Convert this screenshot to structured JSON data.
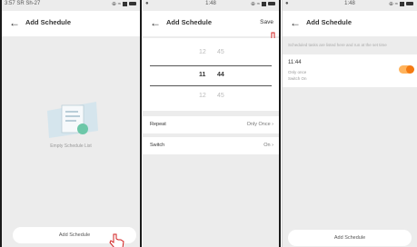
{
  "screens": [
    {
      "status": {
        "left": "3:57 SR Sh-27",
        "center": "1:46",
        "right": "⊕ ≈"
      },
      "header": {
        "back_icon": "arrow-left-icon",
        "title": "Add Schedule"
      },
      "empty": {
        "icon": "document-icon",
        "text": "Empty Schedule List"
      },
      "button": {
        "label": "Add Schedule"
      }
    },
    {
      "status": {
        "left": "●",
        "center": "1:48",
        "right": "⊕ ≈"
      },
      "header": {
        "back_icon": "arrow-left-icon",
        "title": "Add Schedule",
        "save": "Save"
      },
      "picker": {
        "hours": [
          "12",
          "11",
          "12"
        ],
        "minutes": [
          "45",
          "44",
          "45"
        ]
      },
      "settings": [
        {
          "label": "Repeat",
          "value": "Only Once"
        },
        {
          "label": "Switch",
          "value": "On"
        }
      ]
    },
    {
      "status": {
        "left": "●",
        "center": "1:48",
        "right": "⊕ ≈"
      },
      "header": {
        "back_icon": "arrow-left-icon",
        "title": "Add Schedule"
      },
      "section_label": "Scheduled tasks are listed here and run at the set time",
      "schedule": {
        "time": "11:44",
        "line1": "Only once",
        "line2": "Switch On",
        "enabled": true
      },
      "button": {
        "label": "Add Schedule"
      }
    }
  ],
  "colors": {
    "accent": "#f47a12",
    "toggle_track": "#ffb35c",
    "background": "#ececec"
  }
}
